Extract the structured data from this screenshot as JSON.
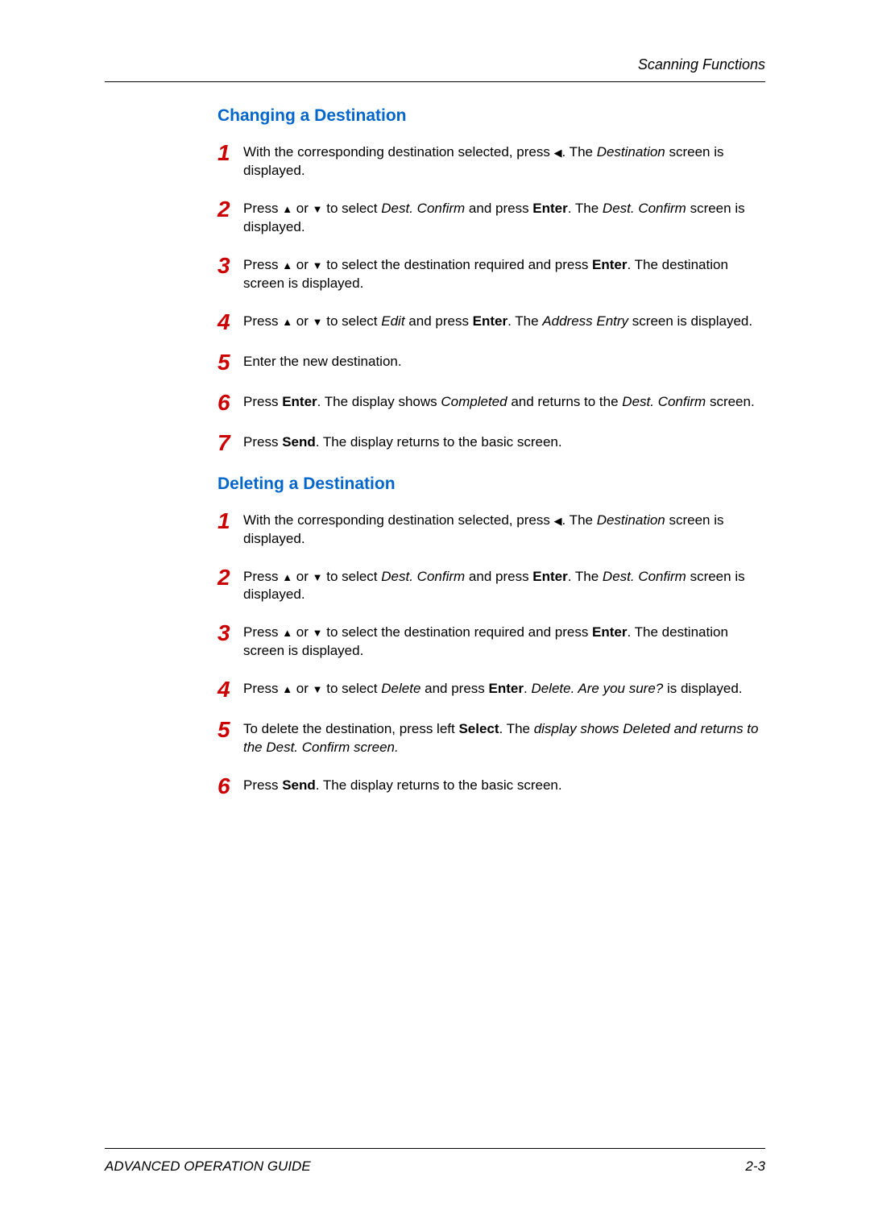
{
  "header": {
    "title": "Scanning Functions"
  },
  "sections": {
    "changing": {
      "heading": "Changing a Destination",
      "steps": {
        "s1": {
          "pre": "With the corresponding destination selected, press ",
          "arrow": "◀",
          "post1": ". The ",
          "italic1": "Destination",
          "post2": " screen is displayed."
        },
        "s2": {
          "pre": "Press ",
          "arrow1": "▲",
          "mid1": " or ",
          "arrow2": "▼",
          "mid2": " to select ",
          "italic1": "Dest. Confirm",
          "mid3": " and press ",
          "bold1": "Enter",
          "mid4": ". The ",
          "italic2": "Dest. Confirm",
          "post": " screen is displayed."
        },
        "s3": {
          "pre": "Press ",
          "arrow1": "▲",
          "mid1": " or ",
          "arrow2": "▼",
          "mid2": " to select the destination required and press ",
          "bold1": "Enter",
          "post": ". The destination screen is displayed."
        },
        "s4": {
          "pre": "Press ",
          "arrow1": "▲",
          "mid1": " or ",
          "arrow2": "▼",
          "mid2": " to select ",
          "italic1": "Edit",
          "mid3": " and press ",
          "bold1": "Enter",
          "mid4": ". The ",
          "italic2": "Address Entry",
          "post": " screen is displayed."
        },
        "s5": {
          "text": "Enter the new destination."
        },
        "s6": {
          "pre": "Press ",
          "bold1": "Enter",
          "mid1": ". The display shows ",
          "italic1": "Completed",
          "mid2": " and returns to the ",
          "italic2": "Dest. Confirm",
          "post": " screen."
        },
        "s7": {
          "pre": "Press ",
          "bold1": "Send",
          "post": ". The display returns to the basic screen."
        }
      }
    },
    "deleting": {
      "heading": "Deleting a Destination",
      "steps": {
        "s1": {
          "pre": "With the corresponding destination selected, press ",
          "arrow": "◀",
          "post1": ". The ",
          "italic1": "Destination",
          "post2": " screen is displayed."
        },
        "s2": {
          "pre": "Press ",
          "arrow1": "▲",
          "mid1": " or ",
          "arrow2": "▼",
          "mid2": " to select ",
          "italic1": "Dest. Confirm",
          "mid3": " and press ",
          "bold1": "Enter",
          "mid4": ". The ",
          "italic2": "Dest. Confirm",
          "post": " screen is displayed."
        },
        "s3": {
          "pre": "Press ",
          "arrow1": "▲",
          "mid1": " or ",
          "arrow2": "▼",
          "mid2": " to select the destination required and press ",
          "bold1": "Enter",
          "post": ". The destination screen is displayed."
        },
        "s4": {
          "pre": "Press ",
          "arrow1": "▲",
          "mid1": " or ",
          "arrow2": "▼",
          "mid2": " to select ",
          "italic1": "Delete",
          "mid3": " and press ",
          "bold1": "Enter",
          "mid4": ". ",
          "italic2": "Delete. Are you sure?",
          "post": " is displayed."
        },
        "s5": {
          "pre": "To delete the destination, press left ",
          "bold1": "Select",
          "mid1": ". The ",
          "italic1": "display shows Deleted and returns to the Dest. Confirm screen."
        },
        "s6": {
          "pre": "Press ",
          "bold1": "Send",
          "post": ". The display returns to the basic screen."
        }
      }
    }
  },
  "footer": {
    "left": "ADVANCED OPERATION GUIDE",
    "right": "2-3"
  },
  "nums": {
    "n1": "1",
    "n2": "2",
    "n3": "3",
    "n4": "4",
    "n5": "5",
    "n6": "6",
    "n7": "7"
  }
}
